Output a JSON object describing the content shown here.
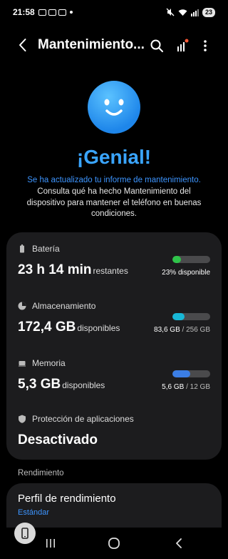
{
  "status_bar": {
    "time": "21:58",
    "battery": "23"
  },
  "app_bar": {
    "title": "Mantenimiento...",
    "icons": [
      "back-arrow-icon",
      "search-icon",
      "signal-notify-icon",
      "more-vert-icon"
    ]
  },
  "hero": {
    "headline": "¡Genial!",
    "updated_text": "Se ha actualizado tu informe de mantenimiento.",
    "description": "Consulta qué ha hecho Mantenimiento del dispositivo para mantener el teléfono en buenas condiciones."
  },
  "colors": {
    "accent": "#3aa5ff",
    "link": "#3d95ff",
    "battery_bar": "#2fc44a",
    "storage_bar": "#18b7d6",
    "memory_bar": "#3b7ee6",
    "card_bg": "#1c1c1e"
  },
  "battery": {
    "label": "Batería",
    "value": "23 h 14 min",
    "unit": "restantes",
    "bar_percent": 23,
    "caption": "23% disponible"
  },
  "storage": {
    "label": "Almacenamiento",
    "value": "172,4 GB",
    "unit": "disponibles",
    "bar_percent": 33,
    "used": "83,6 GB",
    "total": "/ 256 GB"
  },
  "memory": {
    "label": "Memoria",
    "value": "5,3 GB",
    "unit": "disponibles",
    "bar_percent": 47,
    "used": "5,6 GB",
    "total": "/ 12 GB"
  },
  "app_protection": {
    "label": "Protección de aplicaciones",
    "value": "Desactivado"
  },
  "performance": {
    "section_label": "Rendimiento",
    "title": "Perfil de rendimiento",
    "subtitle": "Estándar"
  }
}
